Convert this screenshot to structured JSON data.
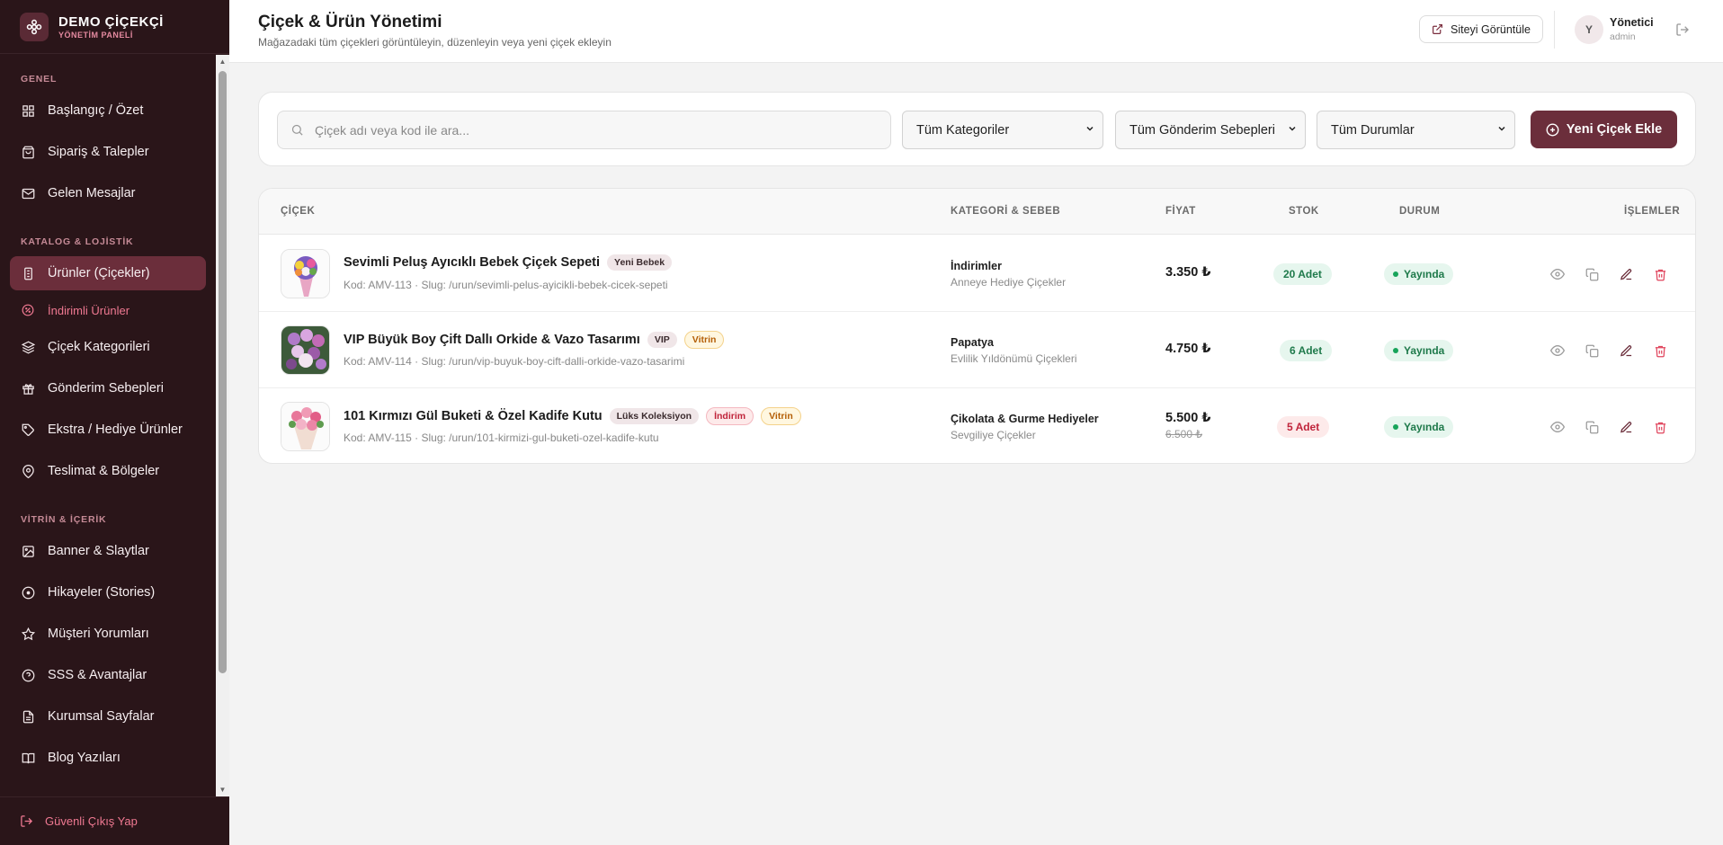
{
  "brand": {
    "name": "DEMO ÇİÇEKÇİ",
    "subtitle": "YÖNETİM PANELİ"
  },
  "sidebar": {
    "sections": [
      {
        "label": "GENEL",
        "items": [
          {
            "label": "Başlangıç / Özet",
            "icon": "grid-icon"
          },
          {
            "label": "Sipariş & Talepler",
            "icon": "shopping-bag-icon"
          },
          {
            "label": "Gelen Mesajlar",
            "icon": "mail-icon"
          }
        ]
      },
      {
        "label": "KATALOG & LOJİSTİK",
        "items": [
          {
            "label": "Ürünler (Çiçekler)",
            "icon": "flower-icon",
            "active": true
          },
          {
            "label": "İndirimli Ürünler",
            "icon": "percent-icon",
            "sub": true
          },
          {
            "label": "Çiçek Kategorileri",
            "icon": "layers-icon"
          },
          {
            "label": "Gönderim Sebepleri",
            "icon": "gift-icon"
          },
          {
            "label": "Ekstra / Hediye Ürünler",
            "icon": "tag-icon"
          },
          {
            "label": "Teslimat & Bölgeler",
            "icon": "map-pin-icon"
          }
        ]
      },
      {
        "label": "VİTRİN & İÇERİK",
        "items": [
          {
            "label": "Banner & Slaytlar",
            "icon": "image-icon"
          },
          {
            "label": "Hikayeler (Stories)",
            "icon": "play-circle-icon"
          },
          {
            "label": "Müşteri Yorumları",
            "icon": "star-icon"
          },
          {
            "label": "SSS & Avantajlar",
            "icon": "help-circle-icon"
          },
          {
            "label": "Kurumsal Sayfalar",
            "icon": "file-icon"
          },
          {
            "label": "Blog Yazıları",
            "icon": "book-icon"
          }
        ]
      }
    ],
    "logout_label": "Güvenli Çıkış Yap"
  },
  "header": {
    "title": "Çiçek & Ürün Yönetimi",
    "subtitle": "Mağazadaki tüm çiçekleri görüntüleyin, düzenleyin veya yeni çiçek ekleyin",
    "view_site_label": "Siteyi Görüntüle",
    "user": {
      "initial": "Y",
      "name": "Yönetici",
      "role": "admin"
    }
  },
  "filters": {
    "search_placeholder": "Çiçek adı veya kod ile ara...",
    "category_select": "Tüm Kategoriler",
    "reason_select": "Tüm Gönderim Sebepleri",
    "status_select": "Tüm Durumlar",
    "add_button": "Yeni Çiçek Ekle"
  },
  "table": {
    "columns": [
      "ÇİÇEK",
      "KATEGORİ & SEBEB",
      "FİYAT",
      "STOK",
      "DURUM",
      "İŞLEMLER"
    ],
    "rows": [
      {
        "name": "Sevimli Peluş Ayıcıklı Bebek Çiçek Sepeti",
        "tags": [
          {
            "label": "Yeni Bebek",
            "style": "gray"
          }
        ],
        "meta": "Kod: AMV-113 · Slug: /urun/sevimli-pelus-ayicikli-bebek-cicek-sepeti",
        "category": "İndirimler",
        "reason": "Anneye Hediye Çiçekler",
        "price": "3.350 ₺",
        "old_price": "",
        "stock": "20 Adet",
        "stock_style": "green",
        "status": "Yayında"
      },
      {
        "name": "VIP Büyük Boy Çift Dallı Orkide & Vazo Tasarımı",
        "tags": [
          {
            "label": "VIP",
            "style": "gray"
          },
          {
            "label": "Vitrin",
            "style": "yellow"
          }
        ],
        "meta": "Kod: AMV-114 · Slug: /urun/vip-buyuk-boy-cift-dalli-orkide-vazo-tasarimi",
        "category": "Papatya",
        "reason": "Evlilik Yıldönümü Çiçekleri",
        "price": "4.750 ₺",
        "old_price": "",
        "stock": "6 Adet",
        "stock_style": "green",
        "status": "Yayında"
      },
      {
        "name": "101 Kırmızı Gül Buketi & Özel Kadife Kutu",
        "tags": [
          {
            "label": "Lüks Koleksiyon",
            "style": "gray"
          },
          {
            "label": "İndirim",
            "style": "red"
          },
          {
            "label": "Vitrin",
            "style": "yellow"
          }
        ],
        "meta": "Kod: AMV-115 · Slug: /urun/101-kirmizi-gul-buketi-ozel-kadife-kutu",
        "category": "Çikolata & Gurme Hediyeler",
        "reason": "Sevgiliye Çiçekler",
        "price": "5.500 ₺",
        "old_price": "6.500 ₺",
        "stock": "5 Adet",
        "stock_style": "red",
        "status": "Yayında"
      }
    ]
  },
  "colors": {
    "sidebar_bg": "#2a1519",
    "accent": "#6b2e3b",
    "link_pink": "#f07992",
    "success": "#17a45a",
    "danger": "#e0445c"
  }
}
